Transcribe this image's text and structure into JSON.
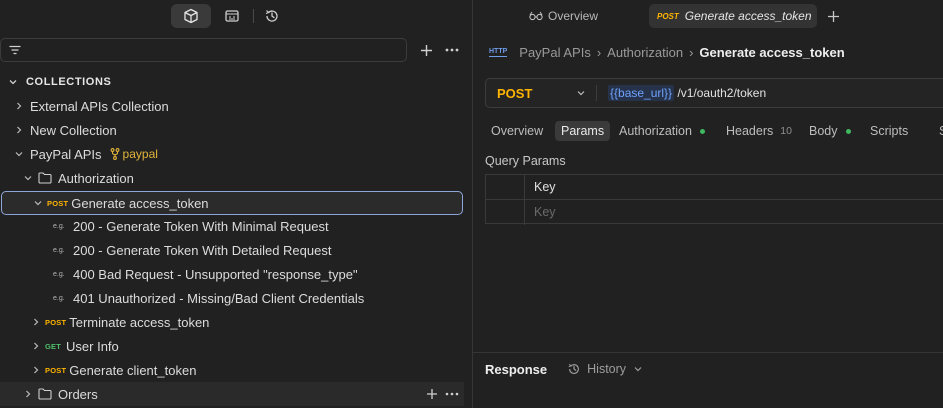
{
  "sidebar": {
    "filter_placeholder": "",
    "collections_header": "COLLECTIONS",
    "tree": [
      {
        "label": "External APIs Collection"
      },
      {
        "label": "New Collection"
      },
      {
        "label": "PayPal APIs",
        "fork": "paypal"
      },
      {
        "label": "Authorization"
      },
      {
        "label": "Generate access_token",
        "method": "POST"
      },
      {
        "label": "200 - Generate Token With Minimal Request",
        "icon": "e.g."
      },
      {
        "label": "200 - Generate Token With Detailed Request",
        "icon": "e.g."
      },
      {
        "label": "400 Bad Request - Unsupported \"response_type\"",
        "icon": "e.g."
      },
      {
        "label": "401 Unauthorized - Missing/Bad Client Credentials",
        "icon": "e.g."
      },
      {
        "label": "Terminate access_token",
        "method": "POST"
      },
      {
        "label": "User Info",
        "method": "GET"
      },
      {
        "label": "Generate client_token",
        "method": "POST"
      },
      {
        "label": "Orders"
      }
    ]
  },
  "tabs": {
    "overview": "Overview",
    "active_method": "POST",
    "active_label": "Generate access_token"
  },
  "breadcrumb": {
    "protocol": "HTTP",
    "collection": "PayPal APIs",
    "folder": "Authorization",
    "current": "Generate access_token"
  },
  "request": {
    "method": "POST",
    "url_var": "{{base_url}}",
    "url_path": " /v1/oauth2/token"
  },
  "request_tabs": {
    "overview": "Overview",
    "params": "Params",
    "authorization": "Authorization",
    "headers": "Headers",
    "headers_count": "10",
    "body": "Body",
    "scripts": "Scripts",
    "settings_initial": "S"
  },
  "params": {
    "label": "Query Params",
    "col_key": "Key",
    "key_placeholder": "Key"
  },
  "response": {
    "label": "Response",
    "history": "History"
  },
  "colors": {
    "accent_post": "#ffb400",
    "accent_get": "#4fbf6c",
    "selection_border": "#8ea6d8",
    "variable": "#6ea3ff",
    "dot_green": "#3fb85f"
  }
}
